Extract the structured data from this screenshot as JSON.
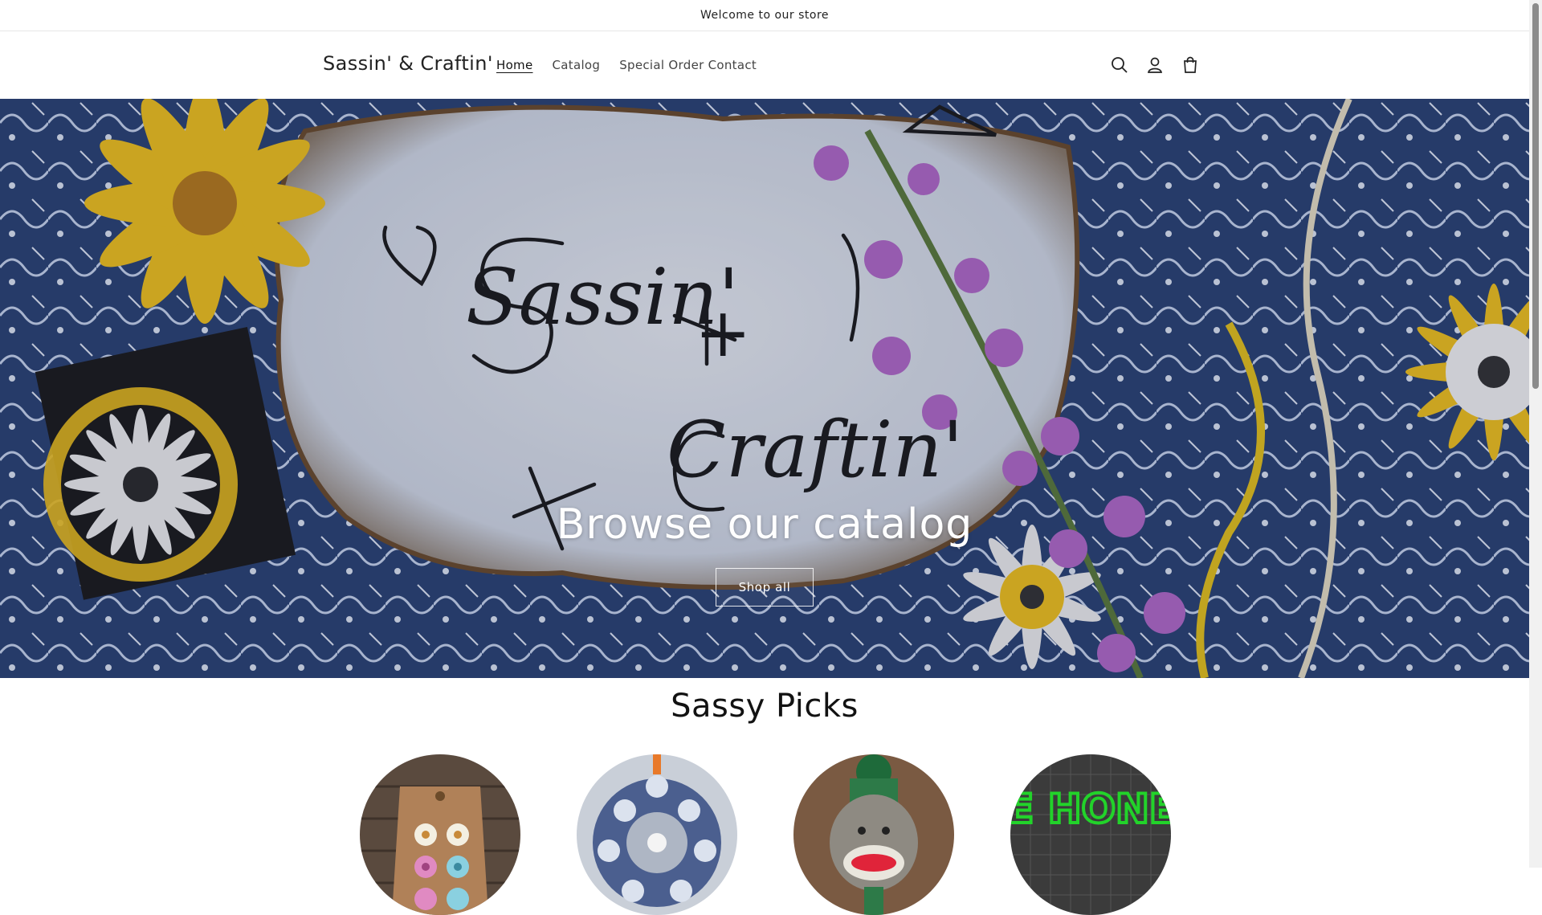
{
  "announcement": {
    "text": "Welcome to our store"
  },
  "header": {
    "logo": "Sassin' & Craftin'",
    "nav": [
      {
        "label": "Home",
        "active": true
      },
      {
        "label": "Catalog",
        "active": false
      },
      {
        "label": "Special Order Contact",
        "active": false
      }
    ],
    "icons": [
      "search-icon",
      "account-icon",
      "cart-icon"
    ]
  },
  "hero": {
    "title": "Browse our catalog",
    "button_label": "Shop all",
    "image_text": [
      "Sassin'",
      "+",
      "Craftin'"
    ]
  },
  "collection": {
    "title": "Sassy Picks",
    "items": [
      {
        "name": "pick-earrings",
        "image_text": ""
      },
      {
        "name": "pick-wreath",
        "image_text": ""
      },
      {
        "name": "pick-sock-monkey",
        "image_text": ""
      },
      {
        "name": "pick-bee-honest",
        "image_text": "BEE HONEST"
      }
    ]
  },
  "colors": {
    "accent": "#121212",
    "hero_base": "#253a64",
    "flower_yellow": "#f2c21b",
    "flower_purple": "#b36ac8",
    "bee_green": "#22d32a"
  }
}
